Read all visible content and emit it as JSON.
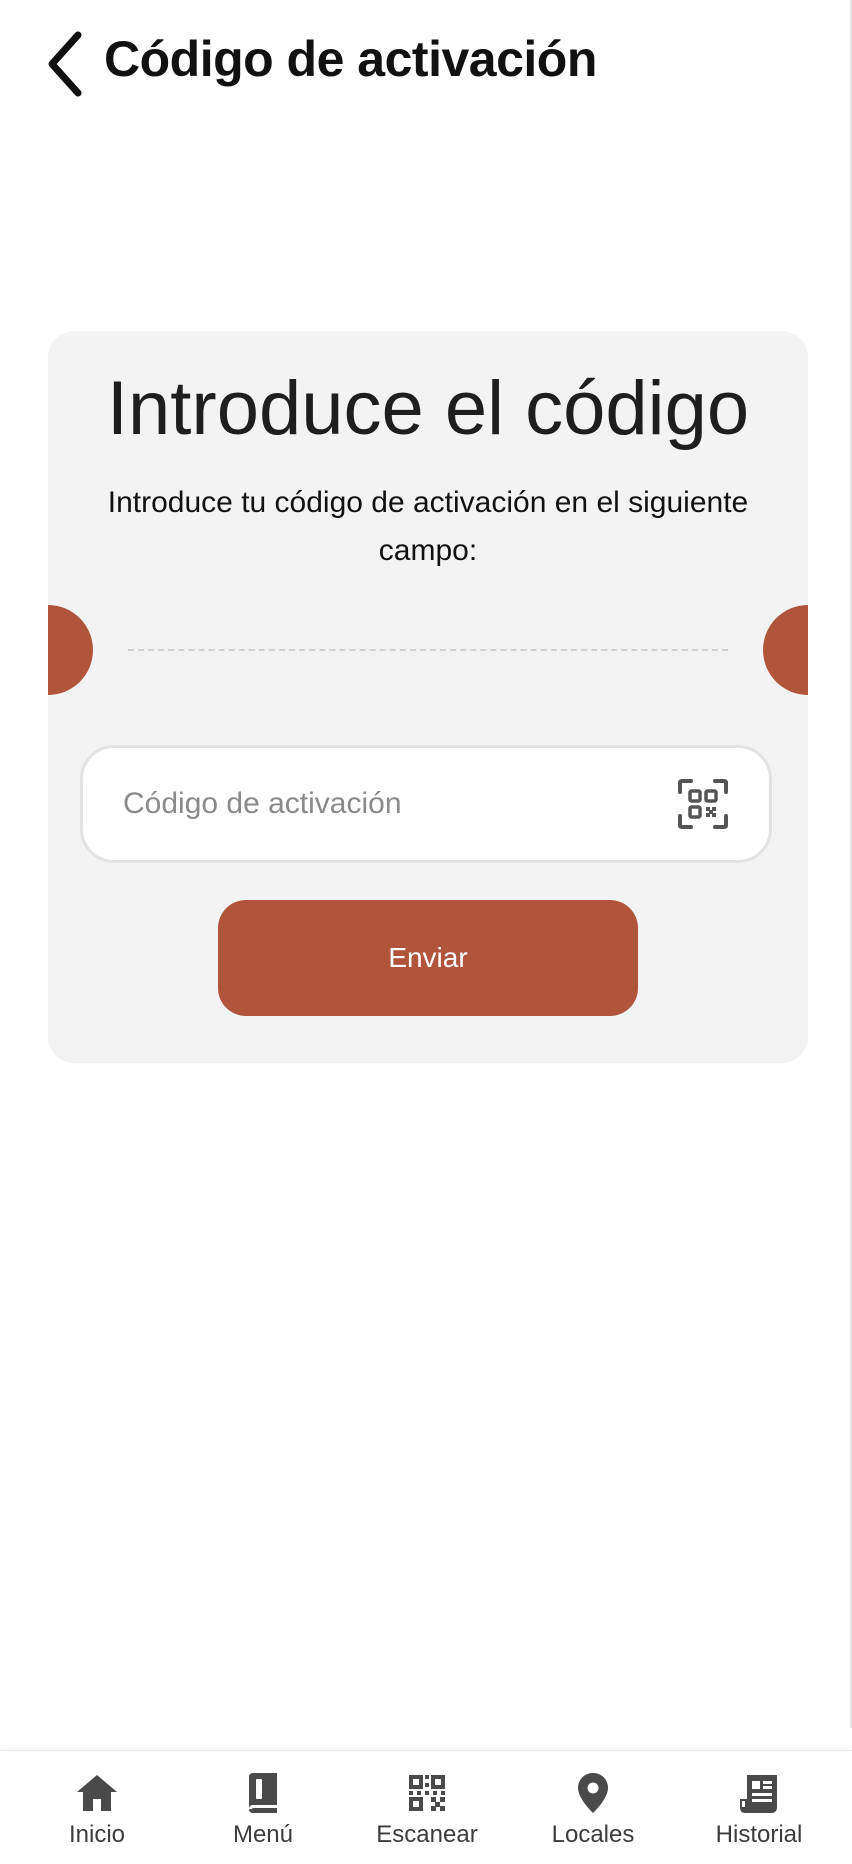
{
  "header": {
    "back_icon": "chevron-left-icon",
    "title": "Código de activación"
  },
  "card": {
    "title": "Introduce el código",
    "description": "Introduce tu código de activación en el siguiente campo:",
    "input": {
      "value": "",
      "placeholder": "Código de activación"
    },
    "scan_icon": "qr-scan-icon",
    "submit_label": "Enviar"
  },
  "bottom_nav": {
    "items": [
      {
        "label": "Inicio",
        "icon": "home-icon"
      },
      {
        "label": "Menú",
        "icon": "book-icon"
      },
      {
        "label": "Escanear",
        "icon": "qr-code-icon"
      },
      {
        "label": "Locales",
        "icon": "map-pin-icon"
      },
      {
        "label": "Historial",
        "icon": "receipt-icon"
      }
    ]
  },
  "colors": {
    "accent": "#b0553c",
    "card_background": "#f3f3f3",
    "text": "#111111",
    "nav_icon": "#4a4a4a"
  }
}
